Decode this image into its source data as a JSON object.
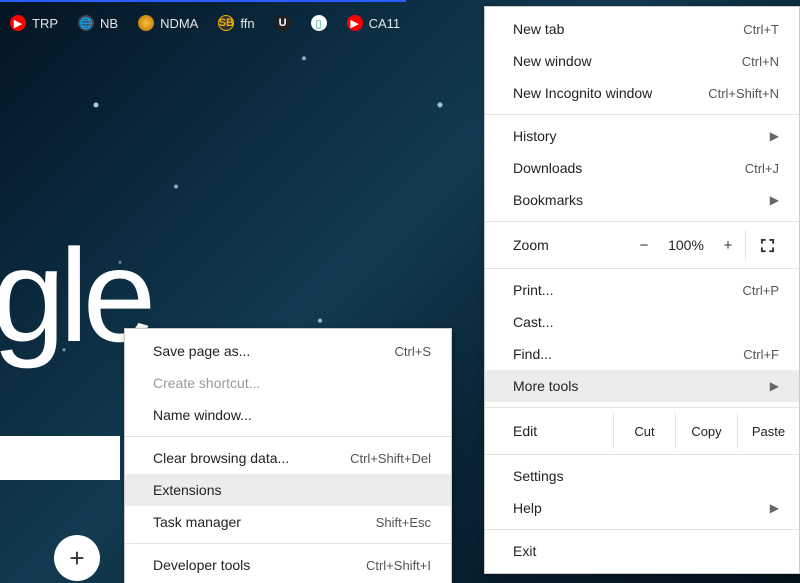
{
  "bookmarks": [
    {
      "label": "TRP",
      "iconClass": "ico-yt",
      "iconName": "youtube-icon"
    },
    {
      "label": "NB",
      "iconClass": "ico-globe",
      "iconName": "globe-icon"
    },
    {
      "label": "NDMA",
      "iconClass": "ico-orange",
      "iconName": "emblem-icon"
    },
    {
      "label": "ffn",
      "iconClass": "ico-sb",
      "iconName": "sb-icon",
      "iconText": "SB"
    },
    {
      "label": "",
      "iconClass": "ico-u",
      "iconName": "u-icon",
      "iconText": "U"
    },
    {
      "label": "",
      "iconClass": "ico-green",
      "iconName": "flag-icon",
      "iconText": ""
    },
    {
      "label": "CA11",
      "iconClass": "ico-yt",
      "iconName": "youtube-icon"
    }
  ],
  "page": {
    "logo_fragment": "gle",
    "add_shortcut": "+"
  },
  "main_menu": {
    "new_tab": {
      "label": "New tab",
      "kbd": "Ctrl+T"
    },
    "new_window": {
      "label": "New window",
      "kbd": "Ctrl+N"
    },
    "new_incognito": {
      "label": "New Incognito window",
      "kbd": "Ctrl+Shift+N"
    },
    "history": {
      "label": "History"
    },
    "downloads": {
      "label": "Downloads",
      "kbd": "Ctrl+J"
    },
    "bookmarks": {
      "label": "Bookmarks"
    },
    "zoom": {
      "label": "Zoom",
      "minus": "−",
      "value": "100%",
      "plus": "+"
    },
    "print": {
      "label": "Print...",
      "kbd": "Ctrl+P"
    },
    "cast": {
      "label": "Cast..."
    },
    "find": {
      "label": "Find...",
      "kbd": "Ctrl+F"
    },
    "more_tools": {
      "label": "More tools"
    },
    "edit": {
      "label": "Edit",
      "cut": "Cut",
      "copy": "Copy",
      "paste": "Paste"
    },
    "settings": {
      "label": "Settings"
    },
    "help": {
      "label": "Help"
    },
    "exit": {
      "label": "Exit"
    }
  },
  "submenu": {
    "save_page": {
      "label": "Save page as...",
      "kbd": "Ctrl+S"
    },
    "create_shortcut": {
      "label": "Create shortcut..."
    },
    "name_window": {
      "label": "Name window..."
    },
    "clear_data": {
      "label": "Clear browsing data...",
      "kbd": "Ctrl+Shift+Del"
    },
    "extensions": {
      "label": "Extensions"
    },
    "task_manager": {
      "label": "Task manager",
      "kbd": "Shift+Esc"
    },
    "dev_tools": {
      "label": "Developer tools",
      "kbd": "Ctrl+Shift+I"
    }
  }
}
